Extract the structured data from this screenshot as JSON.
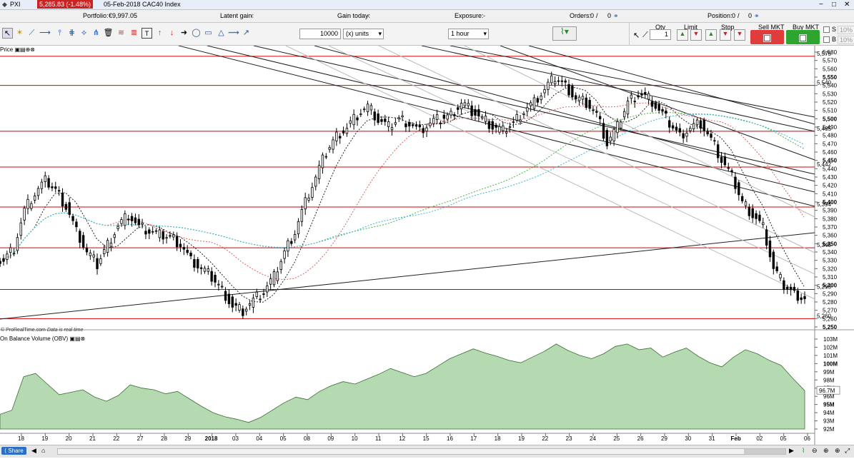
{
  "titlebar": {
    "app": "PXI",
    "price_badge": "5,285.83 (-1.48%)",
    "date_title": "05-Feb-2018 CAC40 Index"
  },
  "account": {
    "portfolio_label": "Portfolio:",
    "portfolio_value": "€9,997.05",
    "latent_label": "Latent gain:",
    "latent_value": "-",
    "today_label": "Gain today:",
    "today_value": "-",
    "exposure_label": "Exposure:",
    "exposure_value": "-",
    "orders_label": "Orders:",
    "orders_value": "0",
    "orders_b": "0",
    "position_label": "Position:",
    "position_value": "0",
    "position_b": "0",
    "sep": "/"
  },
  "toolbar": {
    "quantity": "10000",
    "units": "(x) units",
    "timeframe": "1 hour",
    "qty_label": "Qty",
    "qty_value": "1",
    "limit_label": "Limit",
    "stop_label": "Stop",
    "sell_label": "Sell MKT",
    "buy_label": "Buy MKT",
    "s_label": "S",
    "b_label": "B",
    "ten1": "10",
    "ten2": "10",
    "pct": "%"
  },
  "panels": {
    "price_title": "Price",
    "obv_title": "On Balance Volume (OBV)",
    "source": "© ProRealTime.com",
    "source_note": "Data is real time"
  },
  "colors": {
    "hline": "#d40000",
    "obv_fill": "#b5d9b0",
    "obv_line": "#3a6e34",
    "sell": "#e03c3c",
    "buy": "#2ea52e",
    "badge": "#cc2222"
  },
  "chart_data": {
    "type": "candlestick",
    "price_axis": {
      "min": 5245,
      "max": 5585,
      "ticks": [
        "5,580",
        "5,570",
        "5,560",
        "5,550",
        "5,540",
        "5,530",
        "5,520",
        "5,510",
        "5,500",
        "5,490",
        "5,480",
        "5,470",
        "5,460",
        "5,450",
        "5,440",
        "5,430",
        "5,420",
        "5,410",
        "5,400",
        "5,390",
        "5,380",
        "5,370",
        "5,360",
        "5,350",
        "5,340",
        "5,330",
        "5,320",
        "5,310",
        "5,300",
        "5,290",
        "5,280",
        "5,270",
        "5,260",
        "5,250"
      ]
    },
    "horizontal_levels": [
      {
        "value": 5575,
        "label": "5,575"
      },
      {
        "value": 5540,
        "label": "5,540"
      },
      {
        "value": 5485,
        "label": "5,485"
      },
      {
        "value": 5442,
        "label": "5,442"
      },
      {
        "value": 5394,
        "label": "5,394"
      },
      {
        "value": 5345,
        "label": "5,345"
      },
      {
        "value": 5295,
        "label": "5,295"
      },
      {
        "value": 5260,
        "label": "5,260"
      }
    ],
    "x_labels": [
      "18",
      "19",
      "20",
      "21",
      "22",
      "27",
      "28",
      "29",
      "2018",
      "03",
      "04",
      "05",
      "08",
      "09",
      "10",
      "11",
      "12",
      "15",
      "16",
      "17",
      "18",
      "19",
      "22",
      "23",
      "24",
      "25",
      "26",
      "29",
      "30",
      "31",
      "Feb",
      "02",
      "05",
      "06"
    ],
    "close_path": [
      5330,
      5345,
      5390,
      5410,
      5425,
      5415,
      5395,
      5365,
      5340,
      5325,
      5350,
      5372,
      5385,
      5370,
      5365,
      5360,
      5358,
      5350,
      5330,
      5320,
      5310,
      5295,
      5275,
      5270,
      5282,
      5292,
      5310,
      5340,
      5365,
      5400,
      5430,
      5460,
      5480,
      5490,
      5505,
      5515,
      5498,
      5490,
      5500,
      5495,
      5485,
      5495,
      5500,
      5505,
      5520,
      5510,
      5500,
      5490,
      5485,
      5495,
      5510,
      5520,
      5535,
      5550,
      5540,
      5525,
      5520,
      5505,
      5470,
      5490,
      5520,
      5530,
      5525,
      5510,
      5495,
      5480,
      5490,
      5495,
      5475,
      5450,
      5430,
      5400,
      5385,
      5370,
      5320,
      5300,
      5290,
      5285
    ],
    "obv_axis": {
      "ticks": [
        "103M",
        "102M",
        "101M",
        "100M",
        "99M",
        "98M",
        "97M",
        "96M",
        "95M",
        "94M",
        "93M",
        "92M"
      ],
      "last": "96.7M"
    },
    "obv_path": [
      93.8,
      94.3,
      98.4,
      98.8,
      97.5,
      96.2,
      96.5,
      96.8,
      95.9,
      95.4,
      96.1,
      97.4,
      97.0,
      96.8,
      96.3,
      96.6,
      95.7,
      94.8,
      94.0,
      93.5,
      93.2,
      92.8,
      93.4,
      94.3,
      95.2,
      95.9,
      95.6,
      96.6,
      97.3,
      97.8,
      97.5,
      98.1,
      98.7,
      99.4,
      98.9,
      98.4,
      98.8,
      99.7,
      100.6,
      101.2,
      101.8,
      101.3,
      100.9,
      100.4,
      100.1,
      100.8,
      101.5,
      102.4,
      101.6,
      101.0,
      100.6,
      101.2,
      102.1,
      102.4,
      101.7,
      101.9,
      100.8,
      101.4,
      101.9,
      100.9,
      100.1,
      99.6,
      100.8,
      101.7,
      101.2,
      100.4,
      99.8,
      98.2,
      96.7
    ]
  }
}
